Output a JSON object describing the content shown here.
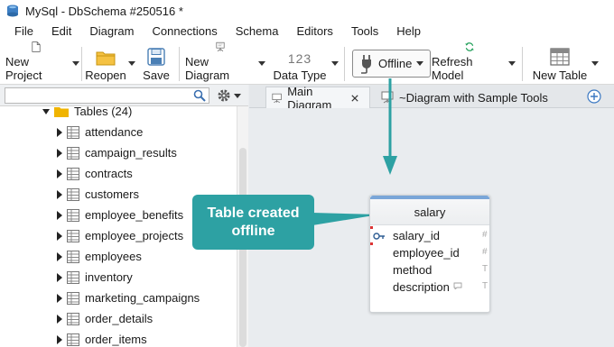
{
  "window": {
    "title": "MySql - DbSchema #250516 *"
  },
  "menu": [
    "File",
    "Edit",
    "Diagram",
    "Connections",
    "Schema",
    "Editors",
    "Tools",
    "Help"
  ],
  "toolbar": {
    "new_project": "New Project",
    "reopen": "Reopen",
    "save": "Save",
    "new_diagram": "New Diagram",
    "data_type": "Data Type",
    "data_type_glyph": "123",
    "offline": "Offline",
    "refresh_model": "Refresh Model",
    "new_table": "New Table"
  },
  "tree": {
    "group": "Tables (24)",
    "items": [
      "attendance",
      "campaign_results",
      "contracts",
      "customers",
      "employee_benefits",
      "employee_projects",
      "employees",
      "inventory",
      "marketing_campaigns",
      "order_details",
      "order_items"
    ]
  },
  "tabs": [
    "Main Diagram",
    "~Diagram with Sample Tools"
  ],
  "diagram_table": {
    "name": "salary",
    "columns": [
      {
        "name": "salary_id",
        "type": "#"
      },
      {
        "name": "employee_id",
        "type": "#"
      },
      {
        "name": "method",
        "type": "T"
      },
      {
        "name": "description",
        "type": "T"
      }
    ]
  },
  "callout": {
    "line1": "Table created",
    "line2": "offline"
  },
  "colors": {
    "accent": "#2da1a3",
    "folder": "#f0b400",
    "refresh": "#22a05a"
  }
}
